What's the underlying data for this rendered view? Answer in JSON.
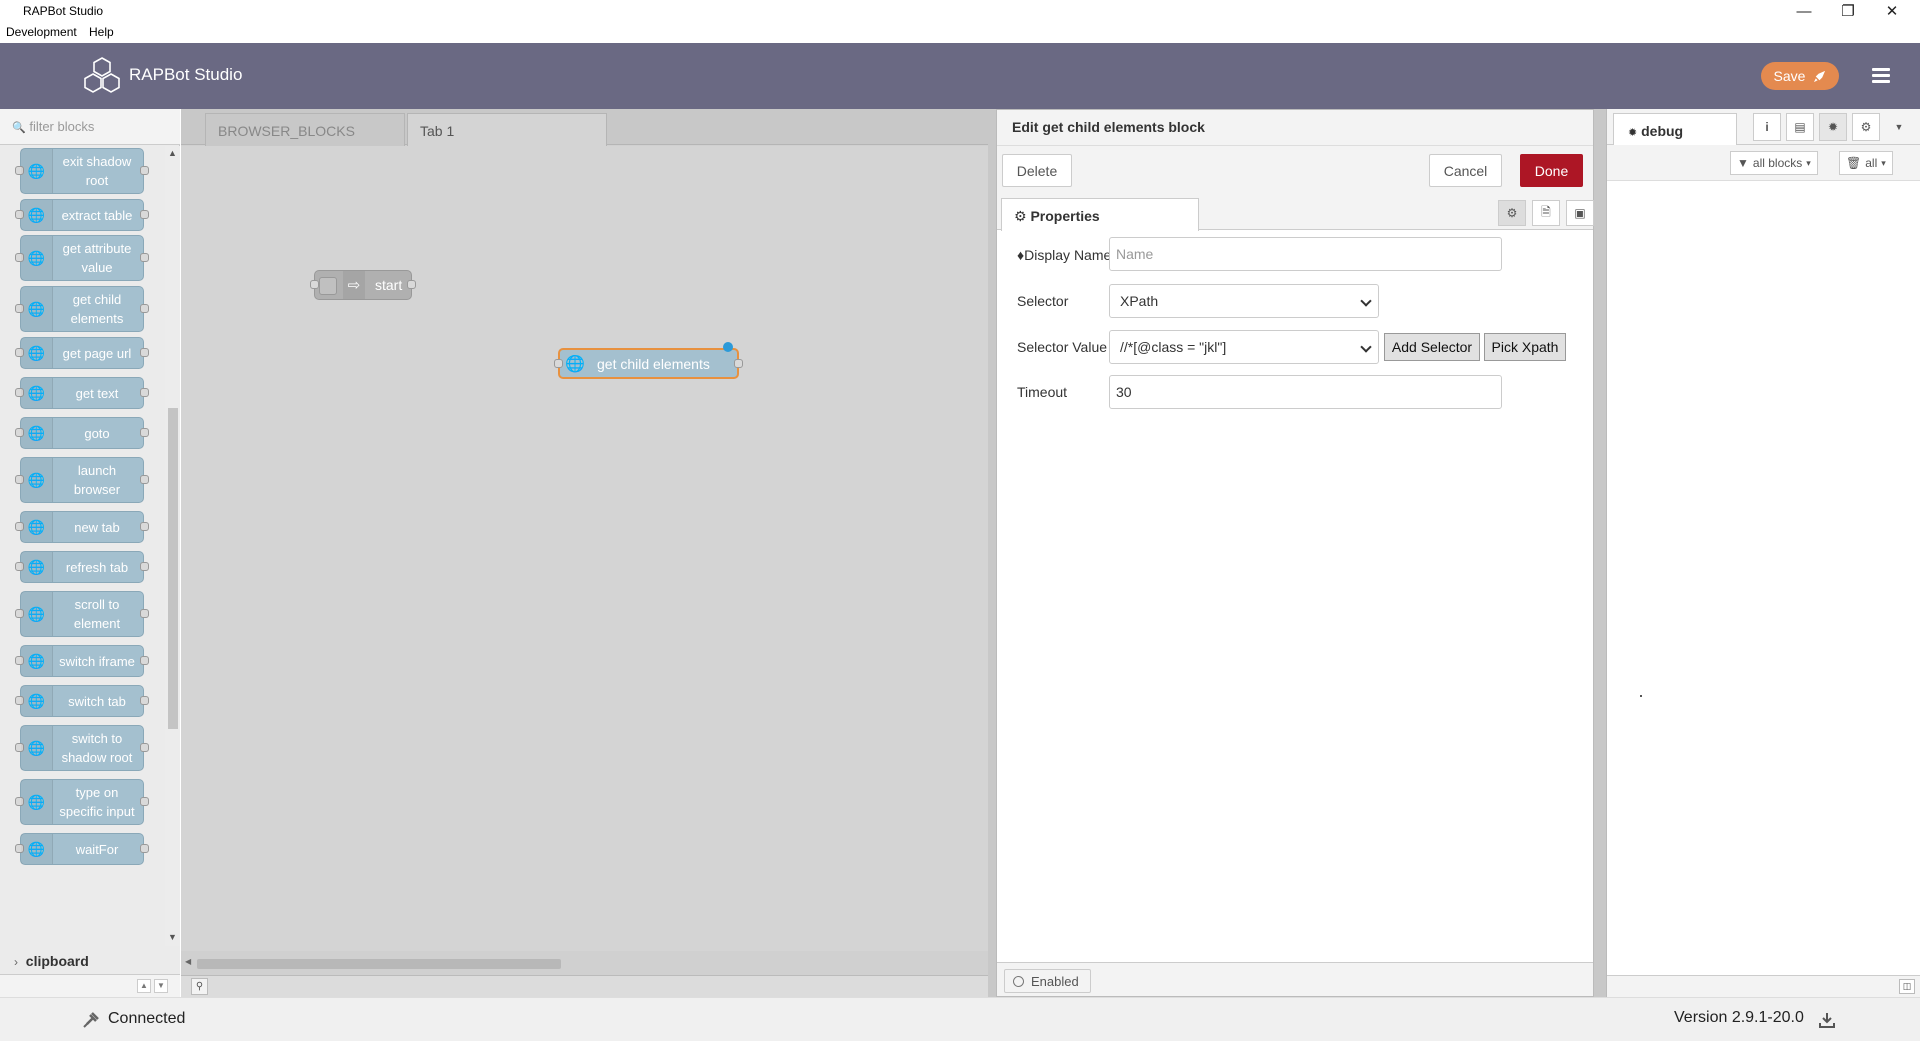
{
  "window": {
    "title": "RAPBot Studio"
  },
  "menu": {
    "items": [
      "Development",
      "Help"
    ]
  },
  "header": {
    "brand": "RAPBot Studio",
    "save_label": "Save"
  },
  "palette": {
    "filter_placeholder": "filter blocks",
    "blocks": [
      "exit shadow root",
      "extract table",
      "get attribute value",
      "get child elements",
      "get page url",
      "get text",
      "goto",
      "launch browser",
      "new tab",
      "refresh tab",
      "scroll to element",
      "switch iframe",
      "switch tab",
      "switch to shadow root",
      "type on specific input",
      "waitFor"
    ],
    "category": "clipboard"
  },
  "workspace": {
    "tabs": [
      "BROWSER_BLOCKS",
      "Tab 1"
    ],
    "nodes": {
      "start": "start",
      "get_child": "get child elements"
    }
  },
  "editor": {
    "title": "Edit get child elements block",
    "delete_label": "Delete",
    "cancel_label": "Cancel",
    "done_label": "Done",
    "properties_tab": "Properties",
    "fields": {
      "display_name_label": "Display Name",
      "display_name_placeholder": "Name",
      "selector_label": "Selector",
      "selector_value": "XPath",
      "selector_value_label": "Selector Value",
      "selector_value_value": "//*[@class = \"jkl\"]",
      "add_selector_label": "Add Selector",
      "pick_xpath_label": "Pick Xpath",
      "timeout_label": "Timeout",
      "timeout_value": "30"
    },
    "enabled_label": "Enabled"
  },
  "sidebar": {
    "tab": "debug",
    "filter_all_blocks": "all blocks",
    "clear_all": "all"
  },
  "status": {
    "connection": "Connected",
    "version": "Version 2.9.1-20.0"
  },
  "colors": {
    "header_bg": "#6a6983",
    "save_btn": "#e48a4f",
    "done_btn": "#ad1625",
    "block_fill": "#a4c0cf",
    "selected_outline": "#e8913f"
  }
}
